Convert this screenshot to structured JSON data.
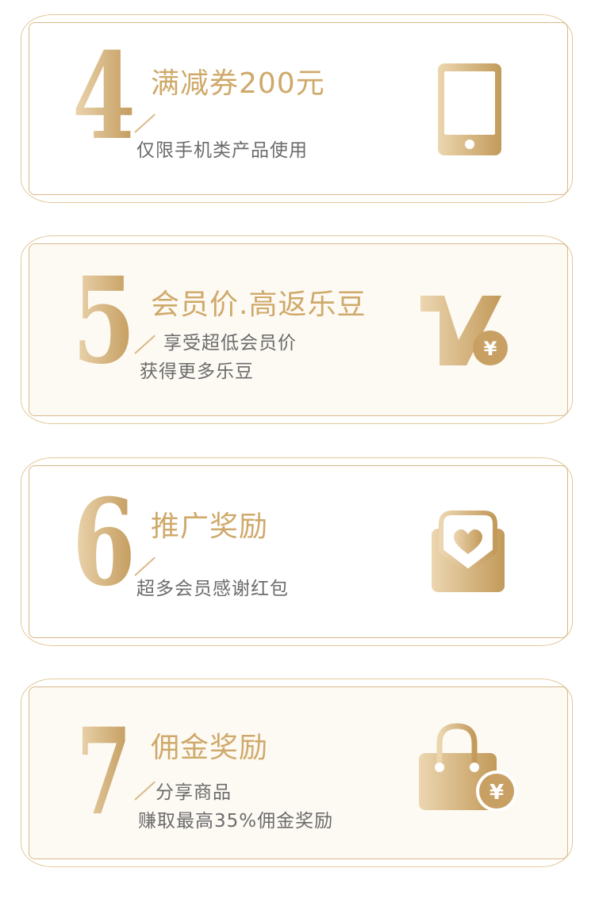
{
  "benefits": [
    {
      "number": "4",
      "title": "满减券200元",
      "lines": [
        "仅限手机类产品使用"
      ],
      "icon": "phone-icon"
    },
    {
      "number": "5",
      "title": "会员价.高返乐豆",
      "lines": [
        "享受超低会员价",
        "获得更多乐豆"
      ],
      "icon": "v-yuan-icon"
    },
    {
      "number": "6",
      "title": "推广奖励",
      "lines": [
        "超多会员感谢红包"
      ],
      "icon": "heart-envelope-icon"
    },
    {
      "number": "7",
      "title": "佣金奖励",
      "lines": [
        "分享商品",
        "赚取最高35%佣金奖励"
      ],
      "icon": "shopping-bag-yuan-icon"
    }
  ],
  "colors": {
    "gold_light": "#ecd6b0",
    "gold_dark": "#c29a5a",
    "text_gray": "#6b6b6b"
  }
}
